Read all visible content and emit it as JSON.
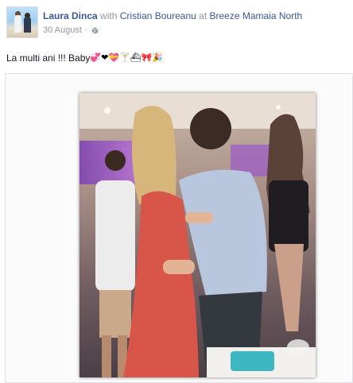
{
  "post": {
    "author": "Laura Dinca",
    "with_word": "with",
    "tagged": "Cristian Boureanu",
    "at_word": "at",
    "place": "Breeze Mamaia North",
    "date": "30 August",
    "separator": "·",
    "privacy_icon": "globe-icon",
    "text": "La multi ani !!! Baby",
    "emoji": [
      "💞",
      "❤",
      "💝",
      "🍸",
      "⛴",
      "🎀",
      "🎉"
    ]
  },
  "colors": {
    "link": "#3b5998",
    "muted": "#9197a3",
    "text": "#141823"
  }
}
